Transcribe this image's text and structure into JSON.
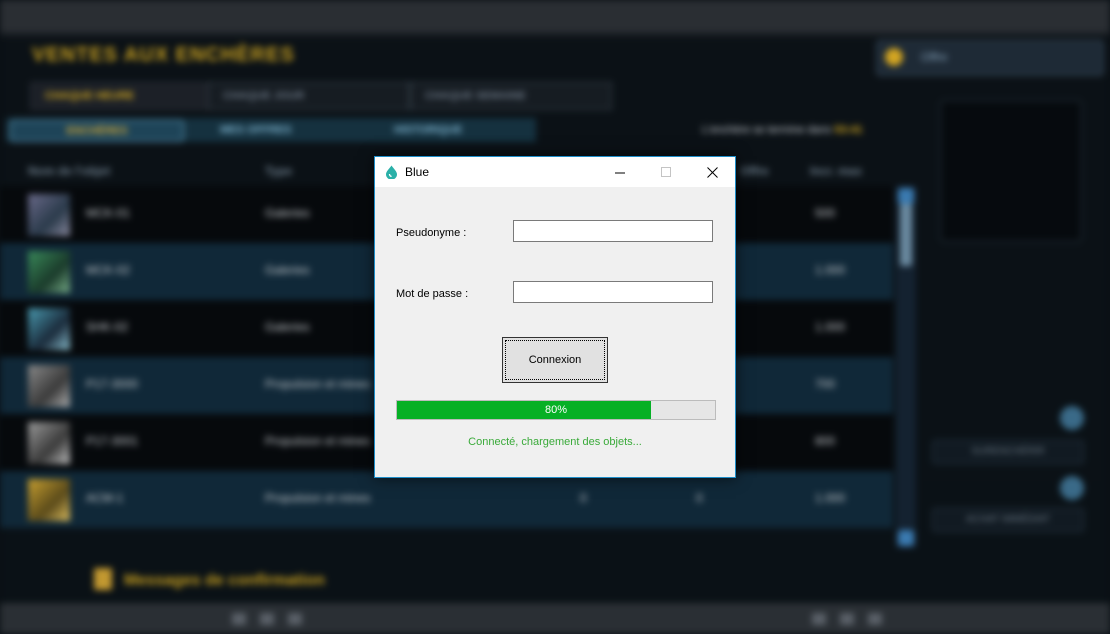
{
  "background": {
    "title": "VENTES AUX ENCHÈRES",
    "tabs": [
      "CHAQUE HEURE",
      "CHAQUE JOUR",
      "CHAQUE SEMAINE"
    ],
    "subtabs": [
      "ENCHÈRES",
      "MES OFFRES",
      "HISTORIQUE"
    ],
    "hint_prefix": "L'enchère se termine dans",
    "hint_value": "53:41",
    "columns": [
      "Nom de l'objet",
      "Type",
      "Offre",
      "Incr. max"
    ],
    "rows": [
      {
        "name": "MCK-01",
        "type": "Galeries",
        "c3": "",
        "c4": "",
        "price": "500"
      },
      {
        "name": "MCK-02",
        "type": "Galeries",
        "c3": "",
        "c4": "",
        "price": "1.000"
      },
      {
        "name": "SHK-02",
        "type": "Galeries",
        "c3": "",
        "c4": "",
        "price": "1.000"
      },
      {
        "name": "P17-3000",
        "type": "Propulsion et mines",
        "c3": "",
        "c4": "",
        "price": "700"
      },
      {
        "name": "P17-3001",
        "type": "Propulsion et mines",
        "c3": "",
        "c4": "",
        "price": "800"
      },
      {
        "name": "ACM-1",
        "type": "Propulsion et mines",
        "c3": "0",
        "c4": "0",
        "price": "1.000"
      }
    ],
    "right_label": "Offre",
    "right_buttons": [
      "SURENCHÉRIR",
      "ACHAT IMMÉDIAT"
    ],
    "footer": "Messages de confirmation"
  },
  "dialog": {
    "title": "Blue",
    "username_label": "Pseudonyme :",
    "username_value": "",
    "password_label": "Mot de passe :",
    "password_value": "",
    "login_button": "Connexion",
    "progress": 80,
    "progress_label": "80%",
    "status": "Connecté, chargement des objets...",
    "colors": {
      "accent_border": "#1e8ec9",
      "progress_fill": "#06b025",
      "status_text": "#3aaa3a",
      "icon": "#2ab0a8"
    },
    "icons": {
      "app": "water-drop-icon",
      "minimize": "minimize-icon",
      "maximize": "maximize-icon",
      "close": "close-icon"
    }
  }
}
